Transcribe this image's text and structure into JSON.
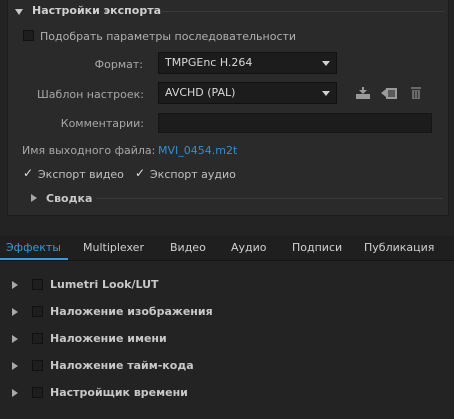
{
  "export_settings": {
    "title": "Настройки экспорта",
    "match_sequence_label": "Подобрать параметры последовательности",
    "format_label": "Формат:",
    "format_value": "TMPGEnc H.264",
    "preset_label": "Шаблон настроек:",
    "preset_value": "AVCHD (PAL)",
    "comments_label": "Комментарии:",
    "comments_value": "",
    "output_name_label": "Имя выходного файла:",
    "output_name_value": "MVI_0454.m2t",
    "export_video_label": "Экспорт видео",
    "export_audio_label": "Экспорт аудио",
    "export_video_checked": true,
    "export_audio_checked": true,
    "summary_label": "Сводка",
    "icons": [
      "save-preset-icon",
      "import-preset-icon",
      "delete-preset-icon"
    ]
  },
  "tabs": [
    {
      "label": "Эффекты",
      "active": true
    },
    {
      "label": "Multiplexer",
      "active": false
    },
    {
      "label": "Видео",
      "active": false
    },
    {
      "label": "Аудио",
      "active": false
    },
    {
      "label": "Подписи",
      "active": false
    },
    {
      "label": "Публикация",
      "active": false
    }
  ],
  "effects": [
    {
      "label": "Lumetri Look/LUT"
    },
    {
      "label": "Наложение изображения"
    },
    {
      "label": "Наложение имени"
    },
    {
      "label": "Наложение тайм-кода"
    },
    {
      "label": "Настройщик времени"
    }
  ],
  "colors": {
    "accent": "#3a9ad9",
    "link": "#2e8fd6",
    "background": "#232323"
  }
}
